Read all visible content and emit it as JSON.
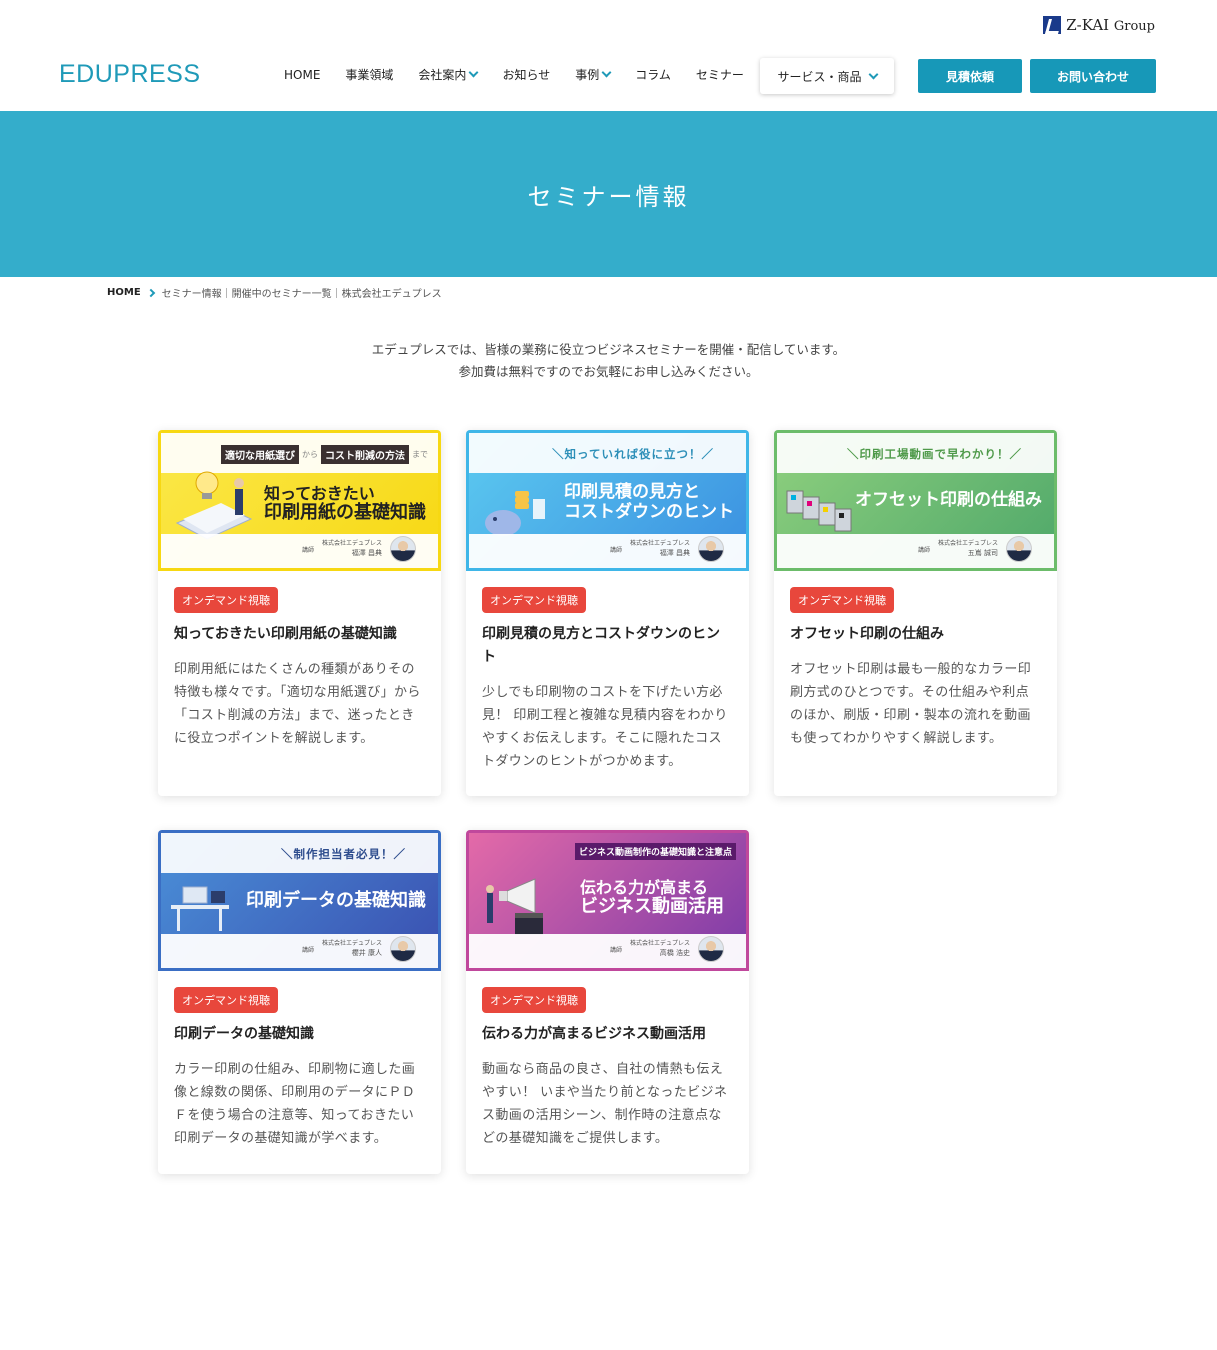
{
  "header": {
    "group_logo": "Z-KAI",
    "group_logo_suffix": "Group",
    "site_logo": "EDUPRESS",
    "nav": [
      "HOME",
      "事業領域",
      "会社案内",
      "お知らせ",
      "事例",
      "コラム",
      "セミナー"
    ],
    "service_button": "サービス・商品",
    "quote_button": "見積依頼",
    "contact_button": "お問い合わせ",
    "accent_color": "#1798b8"
  },
  "hero": {
    "title": "セミナー情報",
    "bg_color": "#34adcb"
  },
  "breadcrumb": {
    "home": "HOME",
    "current": "セミナー情報｜開催中のセミナー一覧｜株式会社エデュプレス"
  },
  "intro": {
    "line1": "エデュプレスでは、皆様の業務に役立つビジネスセミナーを開催・配信しています。",
    "line2": "参加費は無料ですのでお気軽にお申し込みください。"
  },
  "cards": [
    {
      "badge": "オンデマンド視聴",
      "title": "知っておきたい印刷用紙の基礎知識",
      "desc": "印刷用紙にはたくさんの種類がありその特徴も様々です。「適切な用紙選び」から「コスト削減の方法」まで、迷ったときに役立つポイントを解説します。",
      "thumb": {
        "tag1": "適切な用紙選び",
        "tag_mid": "から",
        "tag2": "コスト削減の方法",
        "tag_end": "まで",
        "line1": "知っておきたい",
        "line2": "印刷用紙の基礎知識",
        "speaker_role": "講師",
        "speaker_company": "株式会社エデュプレス",
        "speaker_name": "福澤 昌典",
        "color": "#f7d812"
      }
    },
    {
      "badge": "オンデマンド視聴",
      "title": "印刷見積の見方とコストダウンのヒント",
      "desc": "少しでも印刷物のコストを下げたい方必見！ 印刷工程と複雑な見積内容をわかりやすくお伝えします。そこに隠れたコストダウンのヒントがつかめます。",
      "thumb": {
        "subtitle": "＼知っていれば役に立つ！／",
        "line1": "印刷見積の見方と",
        "line2": "コストダウンのヒント",
        "speaker_role": "講師",
        "speaker_company": "株式会社エデュプレス",
        "speaker_name": "福澤 昌典",
        "color": "#3fb6e8"
      }
    },
    {
      "badge": "オンデマンド視聴",
      "title": "オフセット印刷の仕組み",
      "desc": "オフセット印刷は最も一般的なカラー印刷方式のひとつです。その仕組みや利点のほか、刷版・印刷・製本の流れを動画も使ってわかりやすく解説します。",
      "thumb": {
        "subtitle": "＼印刷工場動画で早わかり！／",
        "line1": "オフセット印刷の仕組み",
        "speaker_role": "講師",
        "speaker_company": "株式会社エデュプレス",
        "speaker_name": "五嶌 誠司",
        "color": "#6cbc6a"
      }
    },
    {
      "badge": "オンデマンド視聴",
      "title": "印刷データの基礎知識",
      "desc": "カラー印刷の仕組み、印刷物に適した画像と線数の関係、印刷用のデータにＰＤＦを使う場合の注意等、知っておきたい印刷データの基礎知識が学べます。",
      "thumb": {
        "subtitle": "＼制作担当者必見！／",
        "line1": "印刷データの基礎知識",
        "speaker_role": "講師",
        "speaker_company": "株式会社エデュプレス",
        "speaker_name": "櫻井 康人",
        "color": "#3a6ec4"
      }
    },
    {
      "badge": "オンデマンド視聴",
      "title": "伝わる力が高まるビジネス動画活用",
      "desc": "動画なら商品の良さ、自社の情熱も伝えやすい！ いまや当たり前となったビジネス動画の活用シーン、制作時の注意点などの基礎知識をご提供します。",
      "thumb": {
        "tag1": "ビジネス動画制作の基礎知識と注意点",
        "line1": "伝わる力が高まる",
        "line2": "ビジネス動画活用",
        "speaker_role": "講師",
        "speaker_company": "株式会社エデュプレス",
        "speaker_name": "高橋 浩史",
        "color": "#c0489c"
      }
    }
  ]
}
